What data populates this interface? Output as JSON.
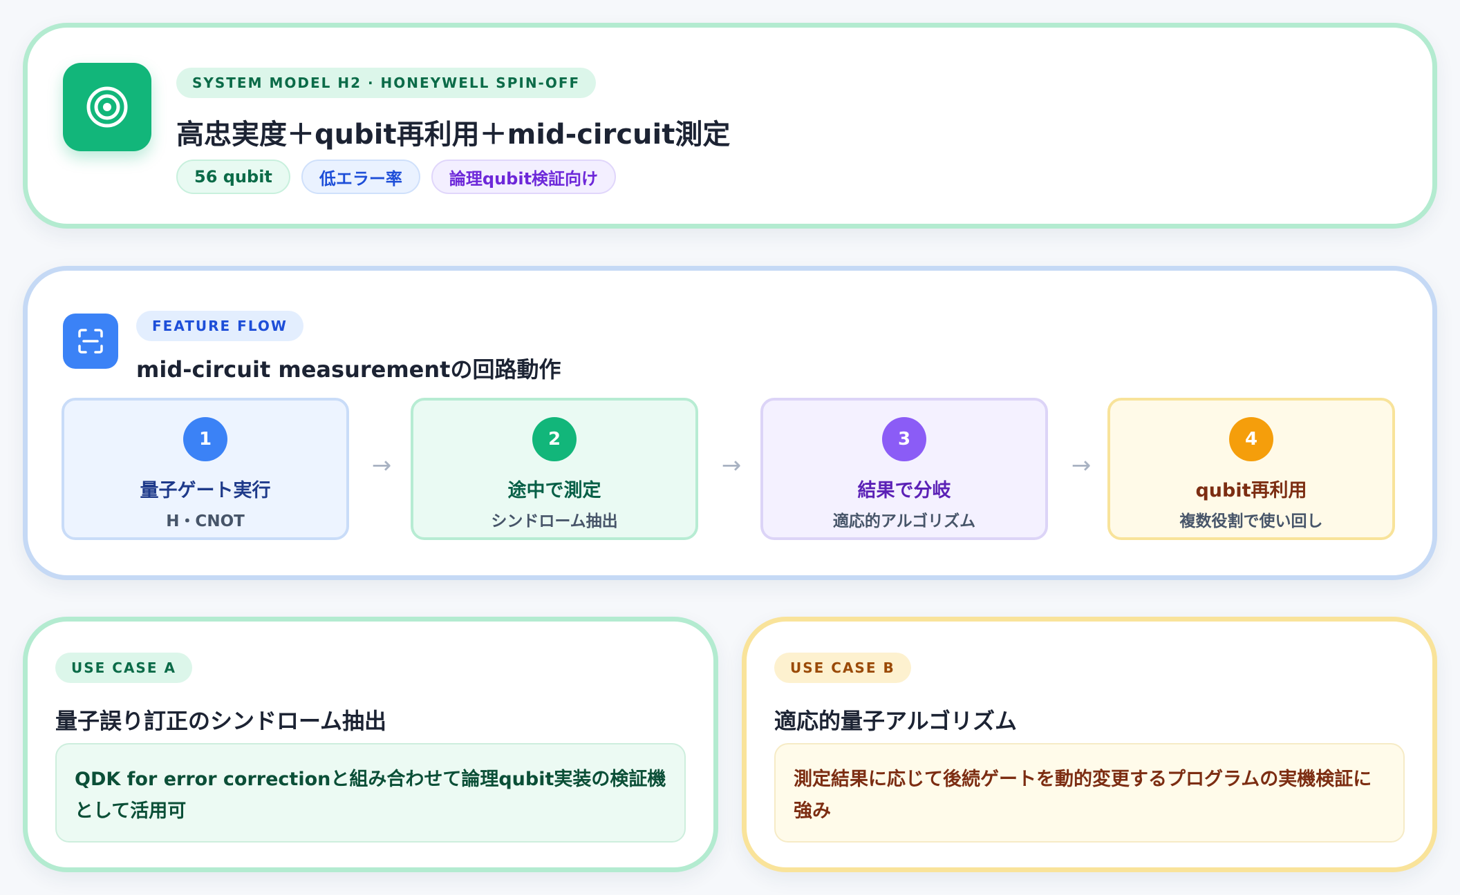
{
  "header": {
    "eyebrow": "SYSTEM MODEL H2 · HONEYWELL SPIN-OFF",
    "title": "高忠実度＋qubit再利用＋mid-circuit測定",
    "tags": [
      "56 qubit",
      "低エラー率",
      "論理qubit検証向け"
    ],
    "icon": "target-icon"
  },
  "flow": {
    "eyebrow": "FEATURE FLOW",
    "title": "mid-circuit measurementの回路動作",
    "icon": "scan-icon",
    "steps": [
      {
        "num": "1",
        "title": "量子ゲート実行",
        "sub": "H・CNOT"
      },
      {
        "num": "2",
        "title": "途中で測定",
        "sub": "シンドローム抽出"
      },
      {
        "num": "3",
        "title": "結果で分岐",
        "sub": "適応的アルゴリズム"
      },
      {
        "num": "4",
        "title": "qubit再利用",
        "sub": "複数役割で使い回し"
      }
    ]
  },
  "use_case_a": {
    "eyebrow": "USE CASE A",
    "title": "量子誤り訂正のシンドローム抽出",
    "desc": "QDK for error correctionと組み合わせて論理qubit実装の検証機として活用可"
  },
  "use_case_b": {
    "eyebrow": "USE CASE B",
    "title": "適応的量子アルゴリズム",
    "desc": "測定結果に応じて後続ゲートを動的変更するプログラムの実機検証に強み"
  },
  "colors": {
    "green": "#12b67a",
    "blue": "#3b82f6",
    "purple": "#8b5cf6",
    "amber": "#f59e0b"
  }
}
